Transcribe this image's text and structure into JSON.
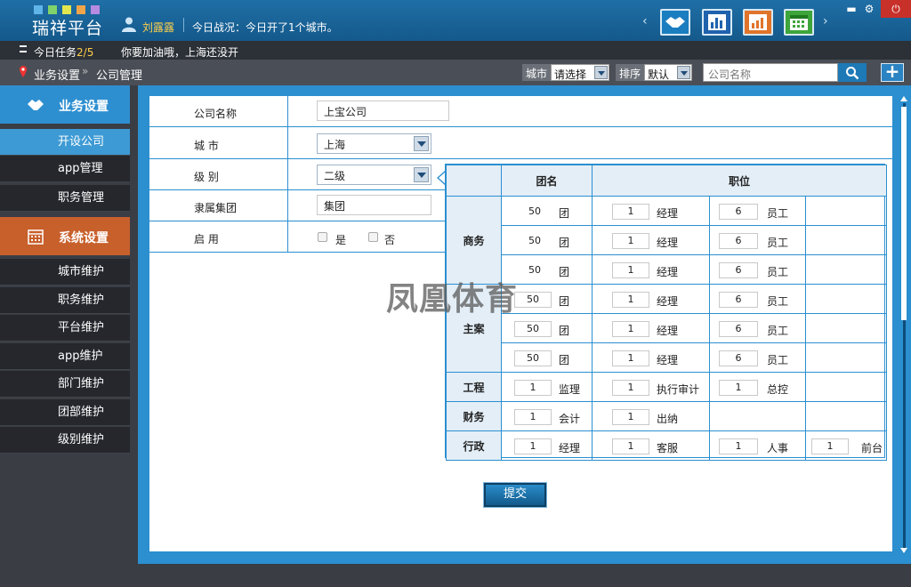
{
  "app": {
    "title": "瑞祥平台",
    "user_name": "刘露露",
    "today_status": "今日战况：今日开了1个城市。"
  },
  "taskbar": {
    "label": "今日任务",
    "count": "2/5",
    "message": "你要加油哦，上海还没开"
  },
  "breadcrumb": {
    "root": "业务设置",
    "separator": "»",
    "current": "公司管理"
  },
  "filters": {
    "city_label": "城市",
    "city_value": "请选择",
    "sort_label": "排序",
    "sort_value": "默认",
    "search_placeholder": "公司名称"
  },
  "sidebar": {
    "section_business": "业务设置",
    "business_items": [
      "开设公司",
      "app管理",
      "职务管理"
    ],
    "section_system": "系统设置",
    "system_items": [
      "城市维护",
      "职务维护",
      "平台维护",
      "app维护",
      "部门维护",
      "团部维护",
      "级别维护"
    ]
  },
  "form": {
    "company_name_label": "公司名称",
    "company_name_value": "上宝公司",
    "city_label": "城    市",
    "city_value": "上海",
    "level_label": "级    别",
    "level_value": "二级",
    "group_label": "隶属集团",
    "group_value": "集团",
    "enabled_label": "启    用",
    "yes_label": "是",
    "no_label": "否",
    "submit_label": "提交"
  },
  "grid": {
    "header_team": "团名",
    "header_position": "职位",
    "cat_business": "商务",
    "cat_main": "主案",
    "cat_engineering": "工程",
    "cat_finance": "财务",
    "cat_admin": "行政",
    "team_value": "50",
    "team_unit": "团",
    "manager_value": "1",
    "manager_unit": "经理",
    "staff_value": "6",
    "staff_unit": "员工",
    "eng": [
      {
        "value": "1",
        "unit": "监理"
      },
      {
        "value": "1",
        "unit": "执行审计"
      },
      {
        "value": "1",
        "unit": "总控"
      }
    ],
    "fin": [
      {
        "value": "1",
        "unit": "会计"
      },
      {
        "value": "1",
        "unit": "出纳"
      }
    ],
    "admin": [
      {
        "value": "1",
        "unit": "经理"
      },
      {
        "value": "1",
        "unit": "客服"
      },
      {
        "value": "1",
        "unit": "人事"
      },
      {
        "value": "1",
        "unit": "前台"
      }
    ]
  },
  "watermark": "凤凰体育",
  "colors": {
    "topbar": "#1f6fa6",
    "accent_blue": "#2b8fd0",
    "sidebar_active": "#3d9ad4",
    "system_section": "#c8602c",
    "username": "#ffd04a"
  }
}
